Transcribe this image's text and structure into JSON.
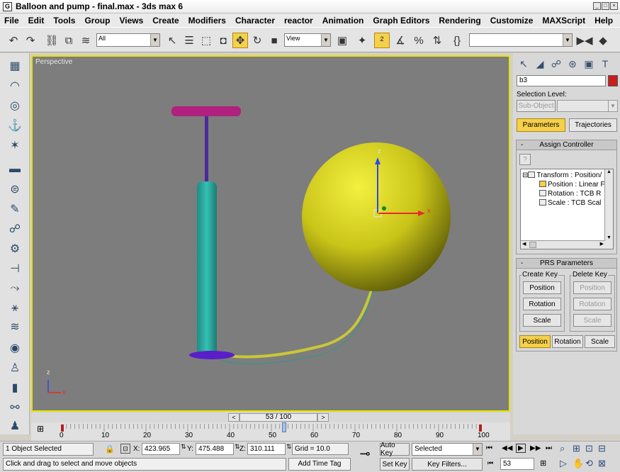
{
  "window": {
    "title": "Balloon and pump - final.max - 3ds max 6",
    "app_icon_glyph": "G"
  },
  "menu": [
    "File",
    "Edit",
    "Tools",
    "Group",
    "Views",
    "Create",
    "Modifiers",
    "Character",
    "reactor",
    "Animation",
    "Graph Editors",
    "Rendering",
    "Customize",
    "MAXScript",
    "Help"
  ],
  "toolbar": {
    "selection_filter": "All",
    "ref_coord": "View"
  },
  "viewport": {
    "label": "Perspective",
    "axis_x": "x",
    "axis_y": "y",
    "axis_z": "z"
  },
  "command_panel": {
    "object_name": "b3",
    "object_color": "#c81e1e",
    "selection_level_label": "Selection Level:",
    "sub_object_label": "Sub-Object",
    "tabs": {
      "parameters": "Parameters",
      "trajectories": "Trajectories"
    },
    "assign_controller": {
      "title": "Assign Controller",
      "minus": "-",
      "tree": [
        {
          "label": "Transform : Position/"
        },
        {
          "label": "Position : Linear F"
        },
        {
          "label": "Rotation : TCB R"
        },
        {
          "label": "Scale : TCB Scal"
        }
      ]
    },
    "prs": {
      "title": "PRS Parameters",
      "minus": "-",
      "create_key": "Create Key",
      "delete_key": "Delete Key",
      "buttons": [
        "Position",
        "Rotation",
        "Scale"
      ],
      "bottom_tabs": [
        "Position",
        "Rotation",
        "Scale"
      ]
    }
  },
  "timeline": {
    "frame_readout": "53 / 100",
    "prev": "<",
    "next": ">",
    "current_frame": 53,
    "total_frames": 100,
    "ticks": [
      "0",
      "10",
      "20",
      "30",
      "40",
      "50",
      "60",
      "70",
      "80",
      "90",
      "100"
    ]
  },
  "status": {
    "selection": "1 Object Selected",
    "prompt": "Click and drag to select and move objects",
    "x_label": "X:",
    "x_value": "423.965",
    "y_label": "Y:",
    "y_value": "475.488",
    "z_label": "Z:",
    "z_value": "310.111",
    "grid": "Grid = 10.0",
    "add_time_tag": "Add Time Tag",
    "auto_key": "Auto Key",
    "set_key": "Set Key",
    "key_mode": "Selected",
    "key_filters": "Key Filters...",
    "frame_field": "53"
  }
}
